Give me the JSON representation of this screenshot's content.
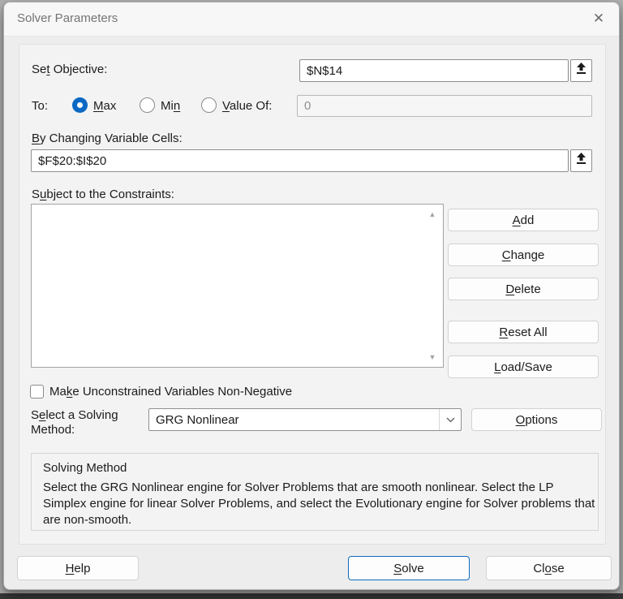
{
  "window": {
    "title": "Solver Parameters",
    "close_glyph": "✕"
  },
  "colors": {
    "accent": "#0F6CBD",
    "radio_blue": "#0B69C4"
  },
  "objective": {
    "label": {
      "pre": "Se",
      "key": "t",
      "post": " Objective:"
    },
    "value": "$N$14"
  },
  "to": {
    "label": "To:",
    "max": {
      "pre": "",
      "key": "M",
      "post": "ax",
      "selected": true
    },
    "min": {
      "pre": "Mi",
      "key": "n",
      "post": "",
      "selected": false
    },
    "value_of": {
      "pre": "",
      "key": "V",
      "post": "alue Of:",
      "selected": false
    },
    "value_of_value": "0"
  },
  "variables": {
    "label": {
      "pre": "",
      "key": "B",
      "post": "y Changing Variable Cells:"
    },
    "value": "$F$20:$I$20"
  },
  "constraints": {
    "label": {
      "pre": "S",
      "key": "u",
      "post": "bject to the Constraints:"
    },
    "items": [],
    "scroll_up_glyph": "▲",
    "scroll_down_glyph": "▼",
    "buttons": {
      "add": {
        "pre": "",
        "key": "A",
        "post": "dd"
      },
      "change": {
        "pre": "",
        "key": "C",
        "post": "hange"
      },
      "delete": {
        "pre": "",
        "key": "D",
        "post": "elete"
      },
      "reset_all": {
        "pre": "",
        "key": "R",
        "post": "eset All"
      },
      "load_save": {
        "pre": "",
        "key": "L",
        "post": "oad/Save"
      }
    }
  },
  "non_negative": {
    "label": {
      "pre": "Ma",
      "key": "k",
      "post": "e Unconstrained Variables Non-Negative"
    },
    "checked": false
  },
  "solving_method": {
    "label": {
      "pre": "S",
      "key": "e",
      "post": "lect a Solving Method:"
    },
    "selected": "GRG Nonlinear",
    "options_button": {
      "pre": "",
      "key": "O",
      "post": "ptions"
    }
  },
  "method_info": {
    "title": "Solving Method",
    "description": "Select the GRG Nonlinear engine for Solver Problems that are smooth nonlinear. Select the LP Simplex engine for linear Solver Problems, and select the Evolutionary engine for Solver problems that are non-smooth."
  },
  "footer": {
    "help": {
      "pre": "",
      "key": "H",
      "post": "elp"
    },
    "solve": {
      "pre": "",
      "key": "S",
      "post": "olve"
    },
    "close": {
      "pre": "Cl",
      "key": "o",
      "post": "se"
    }
  }
}
